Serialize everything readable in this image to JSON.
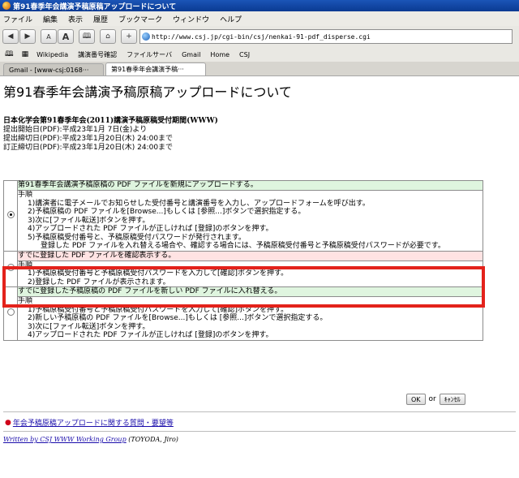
{
  "window": {
    "title": "第91春季年会講演予稿原稿アップロードについて"
  },
  "menu": [
    "ファイル",
    "編集",
    "表示",
    "履歴",
    "ブックマーク",
    "ウィンドウ",
    "ヘルプ"
  ],
  "nav": {
    "back": "◀",
    "forward": "▶",
    "font_small": "A",
    "font_large": "A",
    "book": "🕮",
    "home": "⌂",
    "add": "+",
    "url": "http://www.csj.jp/cgi-bin/csj/nenkai-91-pdf_disperse.cgi"
  },
  "bookmarks": {
    "icons": [
      "🕮",
      "▦"
    ],
    "items": [
      "Wikipedia",
      "講演番号確認",
      "ファイルサーバ",
      "Gmail",
      "Home",
      "CSJ"
    ]
  },
  "tabs": [
    {
      "label": "Gmail - [www-csj:0168···",
      "active": false
    },
    {
      "label": "第91春季年会講演予稿···",
      "active": true
    }
  ],
  "page": {
    "heading": "第91春季年会講演予稿原稿アップロードについて",
    "period_title": "日本化学会第91春季年会(2011)講演予稿原稿受付期間(WWW)",
    "period_lines": [
      "提出開始日(PDF):平成23年1月 7日(金)より",
      "提出締切日(PDF):平成23年1月20日(木) 24:00まで",
      "訂正締切日(PDF):平成23年1月20日(木) 24:00まで"
    ],
    "options": [
      {
        "header": "第91春季年会講演予稿原稿の PDF ファイルを新規にアップロードする。",
        "color": "#dff5df",
        "selected": true,
        "label": "手順",
        "steps": [
          "1)講演者に電子メールでお知らせした受付番号と講演番号を入力し、アップロードフォームを呼び出す。",
          "2)予稿原稿の PDF ファイルを[Browse...]もしくは [参照...]ボタンで選択指定する。",
          "3)次に[ファイル転送]ボタンを押す。",
          "4)アップロードされた PDF ファイルが正しければ [登録]のボタンを押す。",
          "5)予稿原稿受付番号と、予稿原稿受付パスワードが発行されます。"
        ],
        "note": "登録した PDF ファイルを入れ替える場合や、確認する場合には、予稿原稿受付番号と予稿原稿受付パスワードが必要です。"
      },
      {
        "header": "すでに登録した PDF ファイルを確認表示する。",
        "color": "#ffe3e3",
        "selected": false,
        "label": "手順",
        "steps": [
          "1)予稿原稿受付番号と予稿原稿受付パスワードを入力して[確認]ボタンを押す。",
          "2)登録した PDF ファイルが表示されます。"
        ],
        "note": ""
      },
      {
        "header": "すでに登録した予稿原稿の PDF ファイルを新しい PDF ファイルに入れ替える。",
        "color": "#dff5df",
        "selected": false,
        "label": "手順",
        "steps": [
          "1)予稿原稿受付番号と予稿原稿受付パスワードを入力して[確認]ボタンを押す。",
          "2)新しい予稿原稿の PDF ファイルを[Browse...]もしくは [参照...]ボタンで選択指定する。",
          "3)次に[ファイル転送]ボタンを押す。",
          "4)アップロードされた PDF ファイルが正しければ [登録]のボタンを押す。"
        ],
        "note": ""
      }
    ],
    "ok_label": "OK",
    "or_label": "or",
    "cancel_label": "ｷｬﾝｾﾙ",
    "faq_link": "年会予稿原稿アップロードに関する質問・要望等",
    "footer_link": "Written by CSJ WWW Working Group",
    "footer_text": " (TOYODA, Jiro)"
  },
  "colors": {
    "highlight": "#e3221b",
    "link": "#1a0dab",
    "titlebar": "#0a3a92"
  }
}
